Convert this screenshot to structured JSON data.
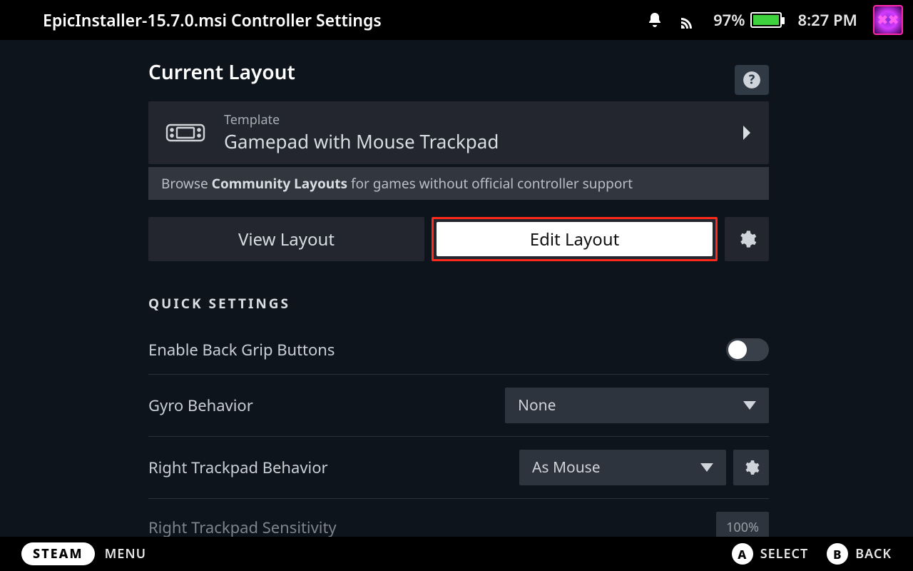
{
  "topbar": {
    "title": "EpicInstaller-15.7.0.msi Controller Settings",
    "battery_pct": "97%",
    "clock": "8:27 PM"
  },
  "layout": {
    "section_title": "Current Layout",
    "template_label": "Template",
    "template_name": "Gamepad with Mouse Trackpad",
    "browse_prefix": "Browse ",
    "browse_bold": "Community Layouts",
    "browse_suffix": " for games without official controller support",
    "view_btn": "View Layout",
    "edit_btn": "Edit Layout"
  },
  "quick": {
    "heading": "QUICK SETTINGS",
    "back_grip_label": "Enable Back Grip Buttons",
    "gyro_label": "Gyro Behavior",
    "gyro_value": "None",
    "rt_behavior_label": "Right Trackpad Behavior",
    "rt_behavior_value": "As Mouse",
    "rt_sens_label": "Right Trackpad Sensitivity",
    "rt_sens_value": "100%"
  },
  "footer": {
    "steam": "STEAM",
    "menu": "MENU",
    "a_label": "SELECT",
    "b_label": "BACK",
    "a_glyph": "A",
    "b_glyph": "B"
  }
}
